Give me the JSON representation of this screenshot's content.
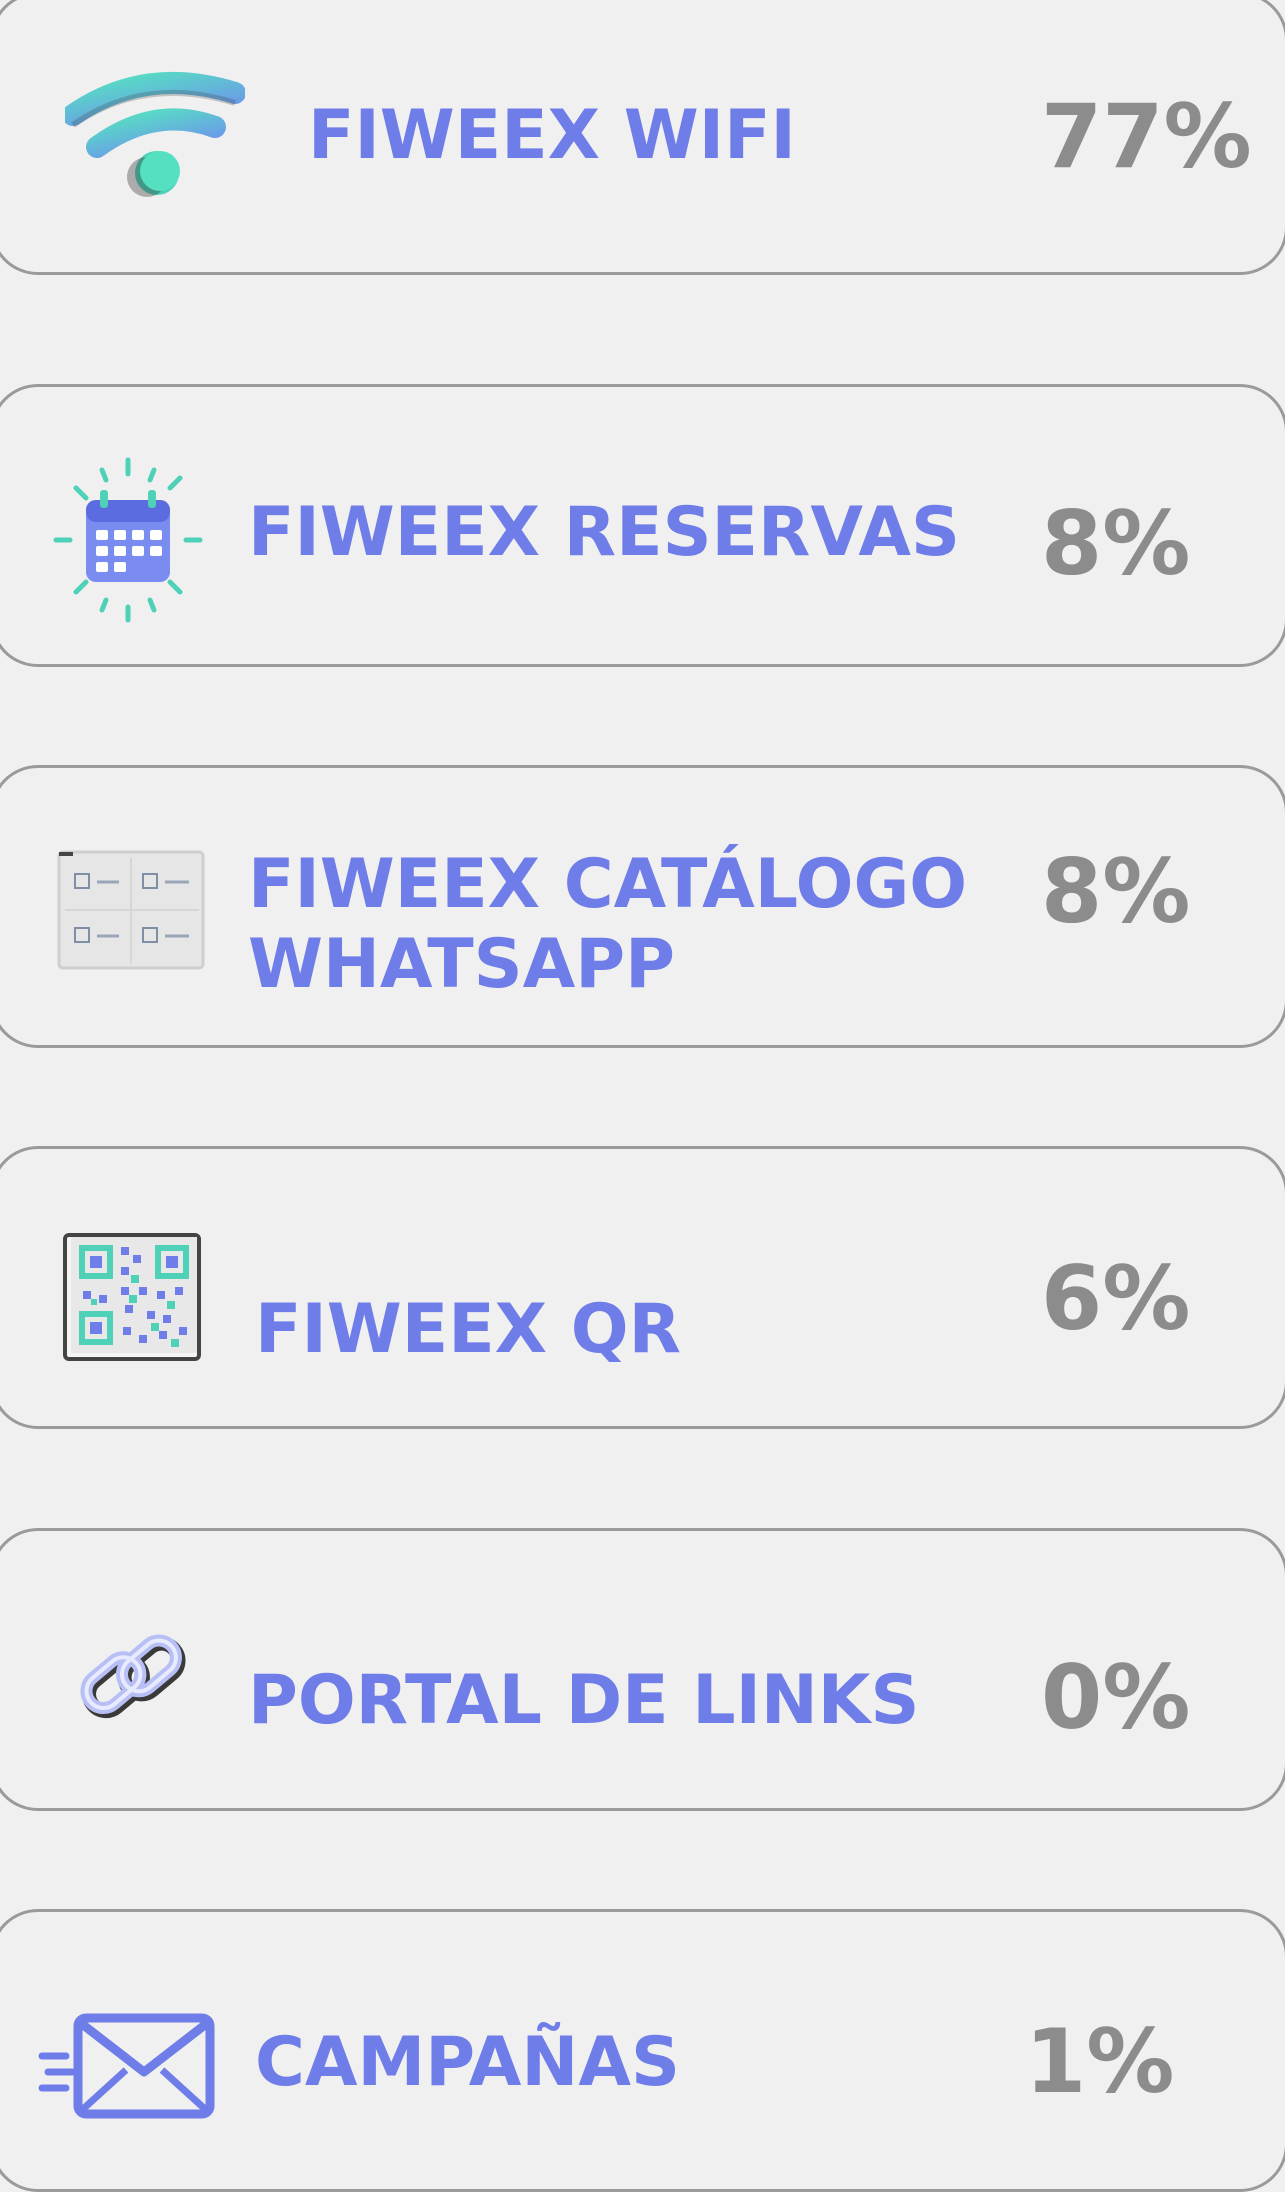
{
  "items": [
    {
      "label": "FIWEEX WIFI",
      "percent": "77%",
      "icon": "wifi-icon"
    },
    {
      "label": "FIWEEX RESERVAS",
      "percent": "8%",
      "icon": "calendar-icon"
    },
    {
      "label_line1": "FIWEEX CATÁLOGO",
      "label_line2": "WHATSAPP",
      "percent": "8%",
      "icon": "catalog-icon"
    },
    {
      "label": "FIWEEX QR",
      "percent": "6%",
      "icon": "qr-code-icon"
    },
    {
      "label": "PORTAL DE LINKS",
      "percent": "0%",
      "icon": "link-icon"
    },
    {
      "label": "CAMPAÑAS",
      "percent": "1%",
      "icon": "envelope-icon"
    }
  ],
  "colors": {
    "label": "#6f7de8",
    "percent": "#8c8c8c",
    "border": "#9a9a9a",
    "background": "#f0f0f0",
    "accent_teal": "#4fd1b8",
    "accent_blue": "#6f7de8"
  }
}
